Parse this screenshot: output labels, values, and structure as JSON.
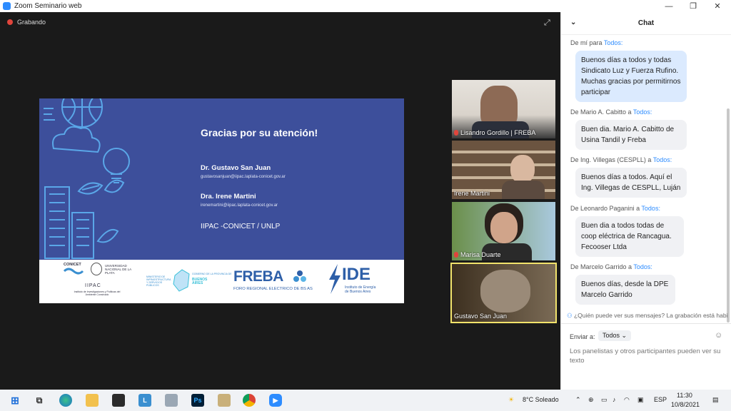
{
  "window": {
    "title": "Zoom Seminario web"
  },
  "stage": {
    "recording_label": "Grabando"
  },
  "slide": {
    "title": "Gracias por su atención!",
    "speaker1_name": "Dr. Gustavo San Juan",
    "speaker1_email": "gustavosanjuan@iipac.laplata-conicet.gov.ar",
    "speaker2_name": "Dra. Irene Martini",
    "speaker2_email": "irenemartini@iipac.laplata-conicet.gov.ar",
    "institution": "IIPAC -CONICET / UNLP",
    "logos": {
      "conicet": "CONICET",
      "unlp": "UNIVERSIDAD NACIONAL DE LA PLATA",
      "iipac": "IIPAC",
      "iipac_sub": "Instituto de Investigaciones y Políticas del Ambiente Construido",
      "ministerio": "MINISTERIO DE INFRAESTRUCTURA Y SERVICIOS PÚBLICOS",
      "gobierno": "GOBIERNO DE LA PROVINCIA DE",
      "buenos_aires": "BUENOS AIRES",
      "freba": "FREBA",
      "freba_sub": "FORO REGIONAL ELECTRICO DE BS AS",
      "ide": "IDE",
      "ide_sub": "Instituto de Energía de Buenos Aires"
    }
  },
  "participants": [
    {
      "name": "Lisandro Gordillo | FREBA",
      "muted": true
    },
    {
      "name": "Irene Martini",
      "muted": false
    },
    {
      "name": "Marisa Duarte",
      "muted": true
    },
    {
      "name": "Gustavo San Juan",
      "muted": false
    }
  ],
  "chat": {
    "title": "Chat",
    "messages": [
      {
        "from": "De mí para",
        "to": "Todos:",
        "text": "Buenos días a todos y todas Sindicato Luz y Fuerza Rufino. Muchas gracias por permitirnos participar"
      },
      {
        "from": "De Mario A. Cabitto a",
        "to": "Todos:",
        "text": "Buen dia. Mario A. Cabitto de Usina Tandil y Freba"
      },
      {
        "from": "De Ing. Villegas (CESPLL) a",
        "to": "Todos:",
        "text": "Buenos días a todos. Aquí el Ing. Villegas de CESPLL, Luján"
      },
      {
        "from": "De Leonardo Paganini a",
        "to": "Todos:",
        "text": "Buen dia a todos todas de coop eléctrica de Rancagua. Fecooser Ltda"
      },
      {
        "from": "De Marcelo Garrido a",
        "to": "Todos:",
        "text": "Buenos días, desde la DPE Marcelo Garrido"
      }
    ],
    "visibility_note": "¿Quién puede ver sus mensajes? La grabación está habilit",
    "send_to_label": "Enviar a:",
    "send_to_value": "Todos",
    "input_placeholder": "Los panelistas y otros participantes pueden ver su texto"
  },
  "taskbar": {
    "weather": "8°C  Soleado",
    "language": "ESP",
    "time": "11:30",
    "date": "10/8/2021"
  }
}
